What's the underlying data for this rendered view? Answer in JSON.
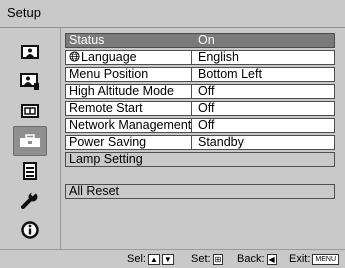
{
  "window": {
    "title": "Setup"
  },
  "nav": {
    "items": [
      {
        "icon": "picture-icon"
      },
      {
        "icon": "picture-adjust-icon"
      },
      {
        "icon": "screen-icon"
      },
      {
        "icon": "setup-toolbox-icon",
        "selected": true
      },
      {
        "icon": "function-list-icon"
      },
      {
        "icon": "wrench-icon"
      },
      {
        "icon": "info-icon"
      }
    ]
  },
  "menu": {
    "rows": [
      {
        "label": "Status",
        "value": "On",
        "selected": true
      },
      {
        "label": "Language",
        "value": "English",
        "globe": true
      },
      {
        "label": "Menu Position",
        "value": "Bottom Left"
      },
      {
        "label": "High Altitude Mode",
        "value": "Off"
      },
      {
        "label": "Remote Start",
        "value": "Off"
      },
      {
        "label": "Network Management",
        "value": "Off"
      },
      {
        "label": "Power Saving",
        "value": "Standby"
      },
      {
        "label": "Lamp Setting",
        "value": ""
      },
      {
        "label": "All Reset",
        "value": ""
      }
    ]
  },
  "footer": {
    "sel_label": "Sel:",
    "set_label": "Set:",
    "back_label": "Back:",
    "exit_label": "Exit:",
    "up_key": "▲",
    "down_key": "▼",
    "enter_key": "⊞",
    "back_key": "◀",
    "menu_key": "MENU"
  },
  "colors": {
    "background": "#c9c9c9",
    "selected_row": "#7a7a7a",
    "row": "#ffffff"
  }
}
